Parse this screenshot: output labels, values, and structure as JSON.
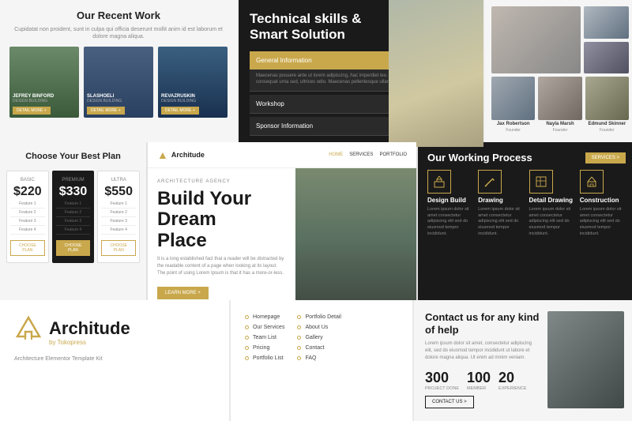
{
  "row1": {
    "recent_work": {
      "title": "Our Recent Work",
      "subtitle": "Cupidatat non proident, sunt in culpa qui officia deserunt mollit anim id est laborum et dolore magna aliqua.",
      "cards": [
        {
          "name": "Jefrey Binford",
          "label": "DESIGN BUILDING",
          "btn": "DETAIL MORE +"
        },
        {
          "name": "Slashoeli",
          "label": "DESIGN BUILDING",
          "btn": "DETAIL MORE +"
        },
        {
          "name": "Revazruskin",
          "label": "DESIGN BUILDING",
          "btn": "DETAIL MORE +"
        }
      ]
    },
    "tech_skills": {
      "title": "Technical skills & Smart Solution",
      "accordion": [
        {
          "label": "General Information",
          "open": true,
          "content": "Maecenas posuere ante ut lorem adipiscing, hac imperdiet leo. Proin eget metus aliquam, consequat urna sed, ultrices odio. Maecenas pellentesque ullamcorper facilisis aenean."
        },
        {
          "label": "Workshop",
          "open": false,
          "content": ""
        },
        {
          "label": "Sponsor Information",
          "open": false,
          "content": ""
        }
      ]
    },
    "team": {
      "members": [
        {
          "name": "Jax Robertson",
          "role": "Founder"
        },
        {
          "name": "Nayla Marsh",
          "role": "Founder"
        },
        {
          "name": "Edmund Skinner",
          "role": "Founder"
        }
      ]
    }
  },
  "row2": {
    "pricing": {
      "title": "Choose Your Best Plan",
      "plans": [
        {
          "name": "BASIC",
          "amount": "$220",
          "featured": false,
          "features": [
            "Feature One",
            "Feature Two",
            "Feature Three",
            "Feature Four"
          ],
          "btn": "CHOOSE PLAN"
        },
        {
          "name": "PREMIUM",
          "amount": "$330",
          "featured": true,
          "features": [
            "Feature One",
            "Feature Two",
            "Feature Three",
            "Feature Four"
          ],
          "btn": "CHOOSE PLAN"
        },
        {
          "name": "ULTRA",
          "amount": "$550",
          "featured": false,
          "features": [
            "Feature One",
            "Feature Two",
            "Feature Three",
            "Feature Four"
          ],
          "btn": "CHOOSE PLAN"
        }
      ]
    },
    "agency": {
      "logo_text": "Architude",
      "nav_links": [
        "HOME",
        "SERVICES",
        "PORTFOLIO"
      ],
      "label": "ARCHITECTURE AGENCY",
      "headline": "Build Your\nDream\nPlace",
      "headline_line1": "Build Your",
      "headline_line2": "Dream",
      "headline_line3": "Place",
      "desc": "It is a long established fact that a reader will be distracted by the readable content of a page when looking at its layout. The point of using Lorem Ipsum is that it has a more-or-less.",
      "cta": "LEARN MORE +"
    },
    "process": {
      "title": "Our Working Process",
      "btn": "SERVICES >",
      "steps": [
        {
          "icon": "⬛",
          "title": "Design Build",
          "desc": "Lorem ipsum dolor sit amet consectetur adipiscing elit sed do eiusmod tempor incididunt."
        },
        {
          "icon": "✏",
          "title": "Drawing",
          "desc": "Lorem ipsum dolor sit amet consectetur adipiscing elit sed do eiusmod tempor incididunt."
        },
        {
          "icon": "📐",
          "title": "Detail Drawing",
          "desc": "Lorem ipsum dolor sit amet consectetur adipiscing elit sed do eiusmod tempor incididunt."
        },
        {
          "icon": "🏗",
          "title": "Construction",
          "desc": "Lorem ipsum dolor sit amet consectetur adipiscing elit sed do eiusmod tempor incididunt."
        }
      ]
    }
  },
  "row3": {
    "brand": {
      "logo_mark": "⌂",
      "name": "Architude",
      "byline": "by Tokopress",
      "desc": "Architecture Elementor Template Kit"
    },
    "sitemap": {
      "col1": [
        "Homepage",
        "Our Services",
        "Team List",
        "Pricing",
        "Portfolio List"
      ],
      "col2": [
        "Portfolio Detail",
        "About Us",
        "Gallery",
        "Contact",
        "FAQ"
      ]
    },
    "contact": {
      "title": "Contact us for any kind of help",
      "desc": "Lorem ipsum dolor sit amet, consectetur adipiscing elit, sed do eiusmod tempor incididunt ut labore et dolore magna aliqua. Ut enim ad minim veniam.",
      "stats": [
        {
          "num": "300",
          "label": "PROJECT DONE"
        },
        {
          "num": "100",
          "label": "MEMBER"
        },
        {
          "num": "20",
          "label": "EXPERIENCE"
        }
      ],
      "cta": "CONTACT US >"
    }
  }
}
